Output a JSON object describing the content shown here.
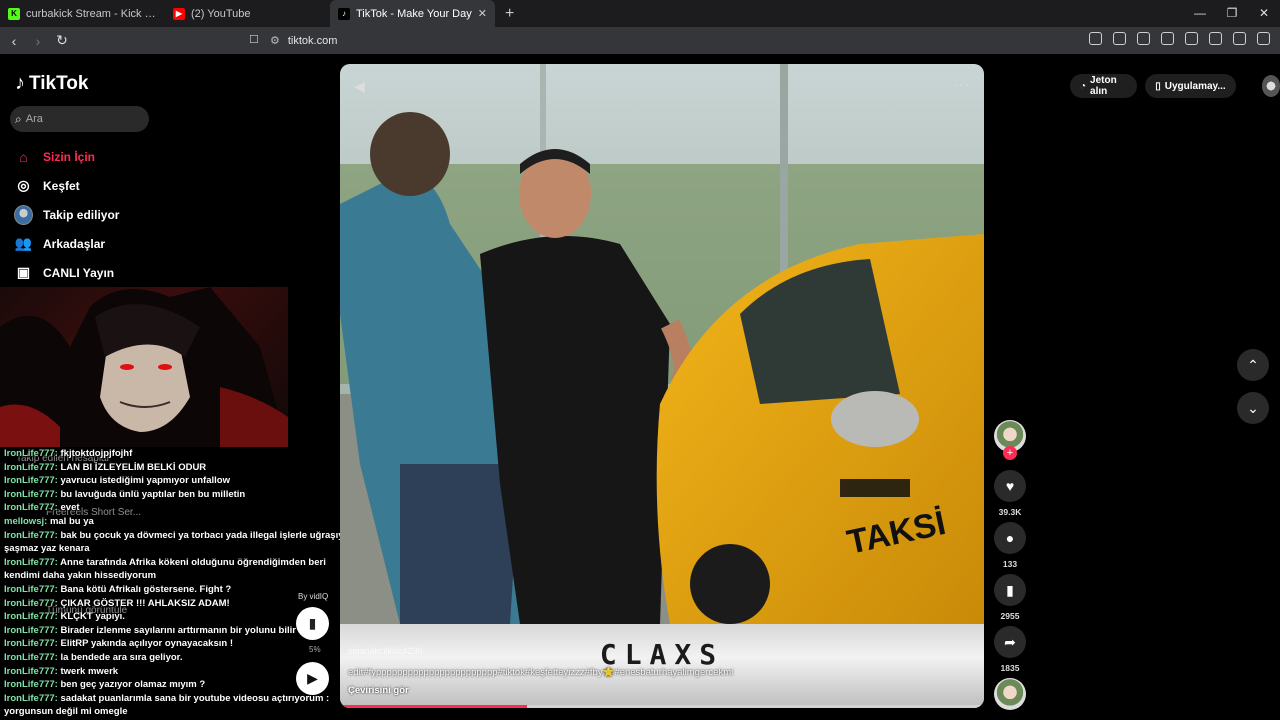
{
  "browser": {
    "tabs": [
      {
        "title": "curbakick Stream - Kick Dashboa",
        "icon": "kick-icon",
        "color": "#53fc18"
      },
      {
        "title": "(2) YouTube",
        "icon": "youtube-icon",
        "color": "#ff0000"
      },
      {
        "title": "TikTok - Make Your Day",
        "icon": "tiktok-icon",
        "color": "#ffffff",
        "active": true
      }
    ],
    "new_tab": "+",
    "url": "tiktok.com"
  },
  "tiktok": {
    "logo": "TikTok",
    "search_placeholder": "Ara",
    "nav": [
      {
        "label": "Sizin İçin",
        "icon": "home-icon",
        "active": true
      },
      {
        "label": "Keşfet",
        "icon": "compass-icon"
      },
      {
        "label": "Takip ediliyor",
        "icon": "following-avatar-icon"
      },
      {
        "label": "Arkadaşlar",
        "icon": "friends-icon"
      },
      {
        "label": "CANLI Yayın",
        "icon": "live-icon"
      }
    ],
    "top_right": {
      "coins": "Jeton alın",
      "app": "Uygulamay..."
    }
  },
  "chat": [
    {
      "user": "IronLife777:",
      "msg": "fkjtoktdojpjfojhf"
    },
    {
      "user": "IronLife777:",
      "msg": "LAN BI İZLEYELİM BELKİ ODUR"
    },
    {
      "user": "IronLife777:",
      "msg": "yavrucu istediğimi yapmıyor unfallow"
    },
    {
      "user": "IronLife777:",
      "msg": "bu lavuğuda ünlü yaptılar ben bu milletin"
    },
    {
      "user": "IronLife777:",
      "msg": "evet"
    },
    {
      "user": "mellowsj:",
      "msg": "mal bu ya"
    },
    {
      "user": "IronLife777:",
      "msg": "bak bu çocuk ya dövmeci ya torbacı yada illegal işlerle uğraşıyor şaşmaz yaz kenara"
    },
    {
      "user": "IronLife777:",
      "msg": "Anne tarafında Afrika kökeni olduğunu öğrendiğimden beri kendimi daha yakın hissediyorum"
    },
    {
      "user": "IronLife777:",
      "msg": "Bana kötü Afrikalı göstersene. Fight ?"
    },
    {
      "user": "IronLife777:",
      "msg": "ÇIKAR GÖSTER !!! AHLAKSIZ ADAM!"
    },
    {
      "user": "IronLife777:",
      "msg": "KLÇKT yapıyı."
    },
    {
      "user": "IronLife777:",
      "msg": "Birader izlenme sayılarını arttırmanın bir yolunu bilir mi"
    },
    {
      "user": "IronLife777:",
      "msg": "ElitRP yakında açılıyor oynayacaksın !"
    },
    {
      "user": "IronLife777:",
      "msg": "la bendede ara sıra geliyor."
    },
    {
      "user": "IronLife777:",
      "msg": "twerk mwerk"
    },
    {
      "user": "IronLife777:",
      "msg": "ben geç yazıyor olamaz mıyım ?"
    },
    {
      "user": "IronLife777:",
      "msg": "sadakat puanlarımla sana bir youtube videosu açtırıyorum : yorgunsun değil mi omegle"
    }
  ],
  "ghost_text": {
    "following_header": "Takip edilen hesaplar",
    "account1": "Freereels Short Ser...",
    "account2": "Tümünü görüntüle"
  },
  "vidiq": {
    "label": "By vidIQ",
    "pct": "5%"
  },
  "video": {
    "author": "sinanakcilkilic4230",
    "description": "edit#fyppppppppppppppppppppppp#tiktok#keşfetteyizzz#fby🌟#enesbaturhayalimgercekmi",
    "translate": "Çevirisini gör",
    "banner_text": "CLAXS",
    "progress": 0.29
  },
  "actions": {
    "likes": "39.3K",
    "comments": "133",
    "saves": "2955",
    "shares": "1835"
  },
  "colors": {
    "accent": "#fe2c55",
    "chat_user": "#7fe3a8"
  }
}
